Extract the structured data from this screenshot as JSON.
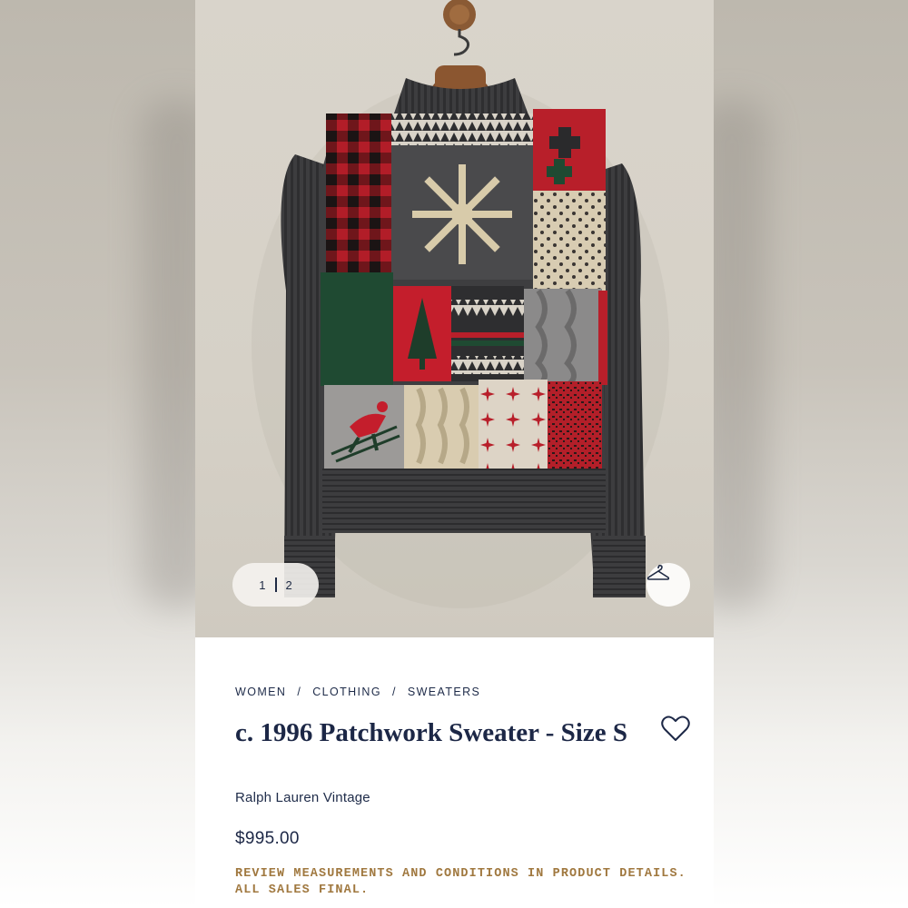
{
  "gallery": {
    "current_page": "1",
    "total_pages": "2",
    "product_image": "patchwork-sweater-on-hanger",
    "hanger_icon": "hanger-icon"
  },
  "breadcrumb": [
    "WOMEN",
    "/",
    "CLOTHING",
    "/",
    "SWEATERS"
  ],
  "product": {
    "title": "c. 1996 Patchwork Sweater - Size S",
    "brand": "Ralph Lauren Vintage",
    "price": "$995.00",
    "notice": "REVIEW MEASUREMENTS AND CONDITIONS IN PRODUCT DETAILS. ALL SALES FINAL.",
    "favorite_icon": "heart-icon"
  },
  "colors": {
    "text_navy": "#1c2746",
    "notice_gold": "#a0783f",
    "sweater_charcoal": "#3e3e40",
    "patch_red": "#b81f2a",
    "patch_green": "#1f4a32",
    "patch_cream": "#d8ccb2"
  }
}
